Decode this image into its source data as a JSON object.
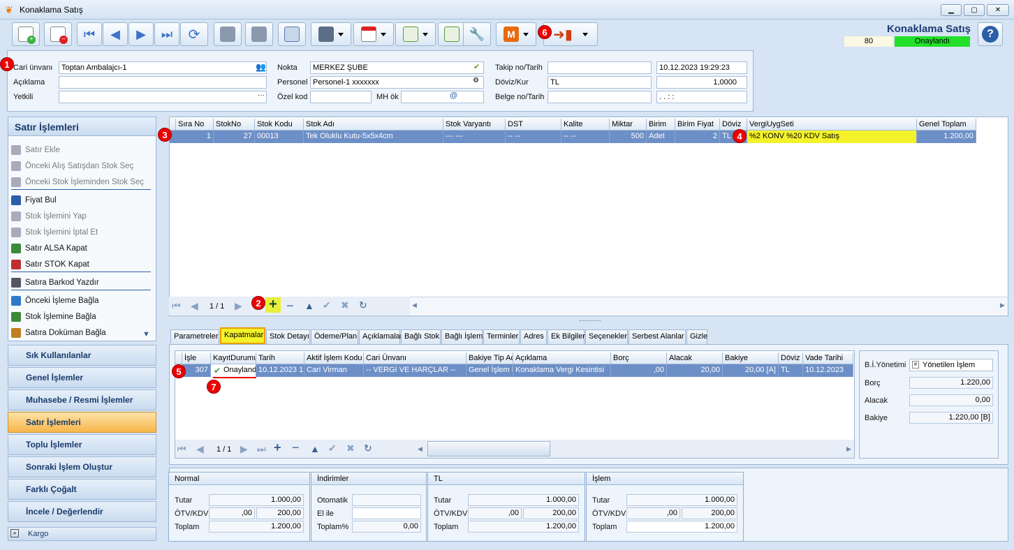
{
  "window": {
    "title": "Konaklama Satış"
  },
  "header": {
    "title": "Konaklama Satış",
    "number": "80",
    "status": "Onaylandı",
    "status_color": "#22e02a"
  },
  "form": {
    "cari_label": "Cari ünvanı",
    "cari_value": "Toptan Ambalajcı-1",
    "aciklama_label": "Açıklama",
    "aciklama_value": "",
    "yetkili_label": "Yetkili",
    "yetkili_value": "",
    "nokta_label": "Nokta",
    "nokta_value": "MERKEZ ŞUBE",
    "personel_label": "Personel",
    "personel_value": "Personel-1 xxxxxxx",
    "ozelkod_label": "Özel kod",
    "ozelkod_value": "",
    "mhok_label": "MH ök",
    "mhok_value": "",
    "takip_label": "Takip no/Tarih",
    "takip_value": "",
    "tarih_value": "10.12.2023 19:29:23",
    "doviz_label": "Döviz/Kur",
    "doviz_value": "TL",
    "kur_value": "1,0000",
    "belge_label": "Belge no/Tarih",
    "belge_value": "",
    "belge_tarih": ". .       :  :"
  },
  "left": {
    "title": "Satır İşlemleri",
    "items": [
      "Satır Ekle",
      "Önceki Alış Satışdan Stok Seç",
      "Önceki Stok İşleminden Stok Seç",
      "Fiyat Bul",
      "Stok İşlemini Yap",
      "Stok İşlemini İptal Et",
      "Satır ALSA Kapat",
      "Satır STOK Kapat",
      "Satıra Barkod Yazdır",
      "Önceki İşleme Bağla",
      "Stok İşlemine Bağla",
      "Satıra Doküman Bağla"
    ],
    "nav": [
      "Sık Kullanılanlar",
      "Genel İşlemler",
      "Muhasebe / Resmi İşlemler",
      "Satır İşlemleri",
      "Toplu İşlemler",
      "Sonraki İşlem Oluştur",
      "Farklı Çoğalt",
      "İncele / Değerlendir",
      "Kargo"
    ]
  },
  "grid": {
    "headers": [
      "Sıra No",
      "StokNo",
      "Stok Kodu",
      "Stok Adı",
      "Stok Varyantı",
      "DST",
      "Kalite",
      "Miktar",
      "Birim",
      "Birim Fiyat",
      "Döviz",
      "VergiUygSeti",
      "Genel Toplam"
    ],
    "row": [
      "1",
      "27",
      "00013",
      "Tek Oluklu Kutu-5x5x4cm",
      "--- ---",
      "-- --",
      "-- --",
      "500",
      "Adet",
      "2",
      "TL",
      "%2 KONV %20 KDV Satış",
      "1.200,00"
    ],
    "pager": "1 / 1"
  },
  "tabs": [
    "Parametreler",
    "Kapatmalar",
    "Stok Detayı",
    "Ödeme/Plan",
    "Açıklamalar",
    "Bağlı Stok",
    "Bağlı İşlem",
    "Terminler",
    "Adres",
    "Ek Bilgiler",
    "Seçenekler",
    "Serbest Alanlar",
    "Gizle"
  ],
  "kapatma": {
    "headers": [
      "İşle",
      "KayıtDurumu",
      "Tarih",
      "Aktif İşlem Kodu",
      "Cari Ünvanı",
      "Bakiye Tip Ac",
      "Açıklama",
      "Borç",
      "Alacak",
      "Bakiye",
      "Döviz",
      "Vade Tarihi"
    ],
    "row": [
      "307",
      "Onaylandı",
      "10.12.2023 1",
      "Cari Virman",
      "-- VERGİ VE HARÇLAR --",
      "Genel İşlem E",
      "Konaklama Vergi Kesintisi",
      ",00",
      "20,00",
      "20,00 [A]",
      "TL",
      "10.12.2023"
    ],
    "pager": "1 / 1"
  },
  "bi": {
    "label": "B.İ.Yönetimi",
    "value": "Yönetilen İşlem",
    "borc_label": "Borç",
    "borc": "1.220,00",
    "alacak_label": "Alacak",
    "alacak": "0,00",
    "bakiye_label": "Bakiye",
    "bakiye": "1.220,00 [B]"
  },
  "sum": {
    "normal": {
      "title": "Normal",
      "tutar_label": "Tutar",
      "tutar": "1.000,00",
      "otv_label": "ÖTV/KDV",
      "otv": ",00",
      "kdv": "200,00",
      "toplam_label": "Toplam",
      "toplam": "1.200,00"
    },
    "indirim": {
      "title": "İndirimler",
      "oto_label": "Otomatik",
      "oto": "",
      "elile_label": "El ile",
      "elile": "",
      "toplamp_label": "Toplam%",
      "toplamp": "0,00"
    },
    "tl": {
      "title": "TL",
      "tutar_label": "Tutar",
      "tutar": "1.000,00",
      "otv_label": "ÖTV/KDV",
      "otv": ",00",
      "kdv": "200,00",
      "toplam_label": "Toplam",
      "toplam": "1.200,00"
    },
    "islem": {
      "title": "İşlem",
      "tutar_label": "Tutar",
      "tutar": "1.000,00",
      "otv_label": "ÖTV/KDV",
      "otv": ",00",
      "kdv": "200,00",
      "toplam_label": "Toplam",
      "toplam": "1.200,00"
    }
  },
  "markers": [
    "1",
    "2",
    "3",
    "4",
    "5",
    "6",
    "7"
  ]
}
